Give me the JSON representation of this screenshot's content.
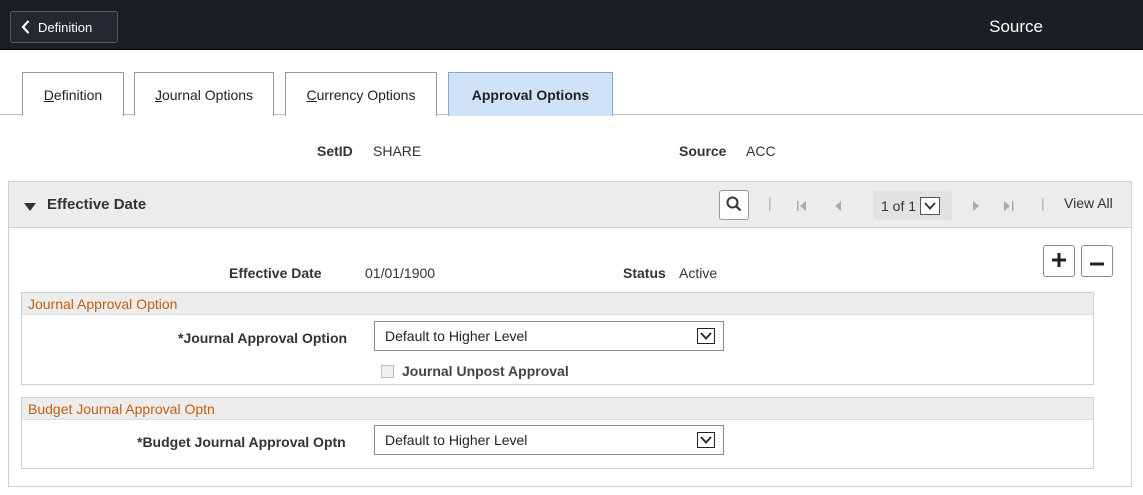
{
  "header": {
    "back_label": "Definition",
    "title": "Source"
  },
  "tabs": [
    {
      "label": "Definition",
      "accesskey": "D",
      "rest": "efinition",
      "active": false
    },
    {
      "label": "Journal Options",
      "accesskey": "J",
      "rest": "ournal Options",
      "active": false
    },
    {
      "label": "Currency Options",
      "accesskey": "C",
      "rest": "urrency Options",
      "active": false
    },
    {
      "label": "Approval Options",
      "accesskey": "",
      "rest": "Approval Options",
      "active": true
    }
  ],
  "keys": {
    "setid_label": "SetID",
    "setid_value": "SHARE",
    "source_label": "Source",
    "source_value": "ACC"
  },
  "effective_group": {
    "title": "Effective Date",
    "pager": "1 of 1",
    "view_all": "View All",
    "effective_date_label": "Effective Date",
    "effective_date_value": "01/01/1900",
    "status_label": "Status",
    "status_value": "Active"
  },
  "journal_approval": {
    "section_title": "Journal Approval Option",
    "field_label": "*Journal Approval Option",
    "field_value": "Default to Higher Level",
    "checkbox_label": "Journal Unpost Approval",
    "checkbox_checked": false
  },
  "budget_approval": {
    "section_title": "Budget Journal Approval Optn",
    "field_label": "*Budget Journal Approval Optn",
    "field_value": "Default to Higher Level"
  },
  "colors": {
    "header_bg": "#1b1f24",
    "active_tab": "#cfe3f8",
    "section_title": "#c2600f"
  }
}
